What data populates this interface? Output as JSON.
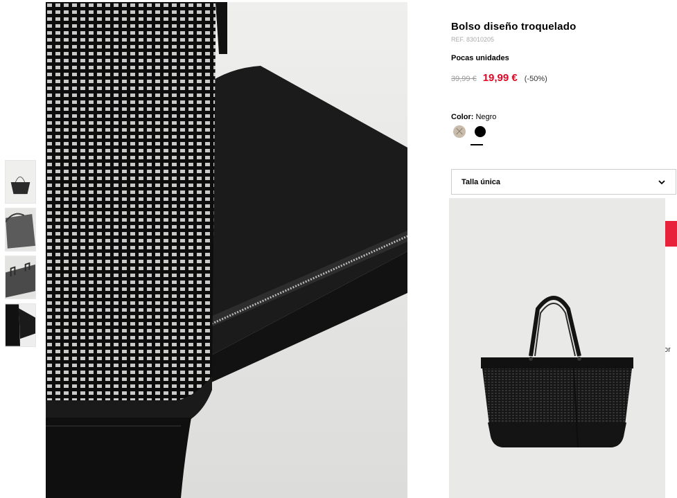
{
  "product": {
    "title": "Bolso diseño troquelado",
    "ref": "REF. 83010205",
    "stock": "Pocas unidades",
    "old_price": "39,99 €",
    "new_price": "19,99 €",
    "discount": "(-50%)"
  },
  "color": {
    "label": "Color:",
    "value": "Negro",
    "swatches": [
      {
        "name": "beige",
        "hex": "#c9bcaa",
        "available": false
      },
      {
        "name": "black",
        "hex": "#000000",
        "available": true,
        "selected": true
      }
    ]
  },
  "size": {
    "selected": "Talla única",
    "icon": "chevron-down-icon"
  },
  "thumbnails": [
    "front-view",
    "side-view",
    "detail-view",
    "close-up-view"
  ],
  "side_text": "or",
  "colors": {
    "price_red": "#e00523",
    "accent_red": "#e8223a"
  }
}
